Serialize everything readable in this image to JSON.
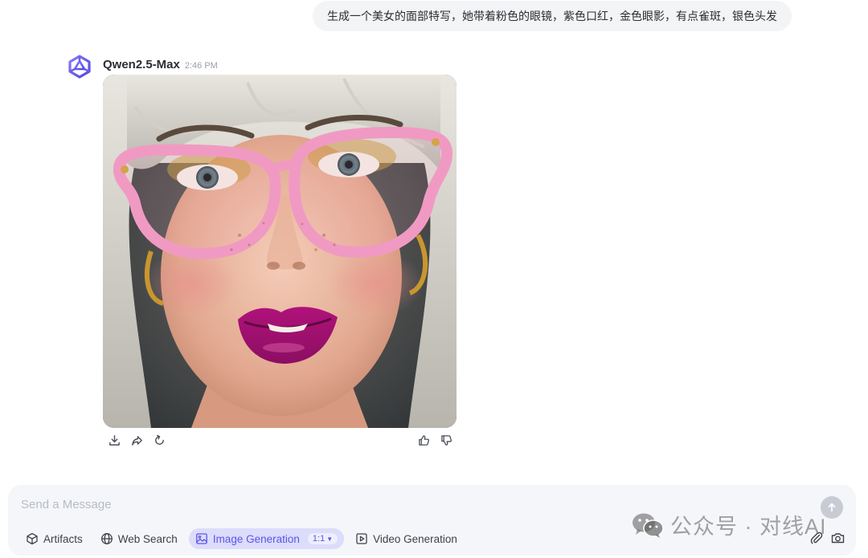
{
  "user_message": "生成一个美女的面部特写，她带着粉色的眼镜，紫色口红，金色眼影，有点雀斑，银色头发",
  "assistant": {
    "model_name": "Qwen2.5-Max",
    "time": "2:46 PM",
    "avatar_icon": "qwen-logo-icon",
    "image_icon": "generated-portrait-image"
  },
  "message_actions": [
    "download-icon",
    "share-icon",
    "regenerate-icon",
    "thumbs-up-icon",
    "thumbs-down-icon"
  ],
  "composer": {
    "placeholder": "Send a Message",
    "tools": {
      "artifacts": "Artifacts",
      "web_search": "Web Search",
      "image_generation": "Image Generation",
      "aspect_ratio": "1:1",
      "video_generation": "Video Generation"
    }
  },
  "watermark": {
    "text": "公众号 · 对线AI"
  },
  "colors": {
    "accent": "#5b55e8",
    "active_tool_bg": "#dcdcfb",
    "bubble_bg": "#f3f4f6",
    "composer_bg": "#f5f6fa"
  }
}
